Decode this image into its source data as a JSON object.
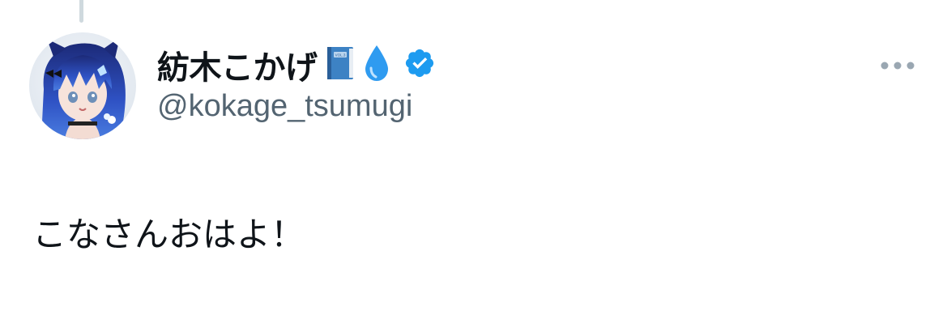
{
  "tweet": {
    "author": {
      "display_name": "紡木こかげ",
      "name_emojis": [
        "blue-book-icon",
        "droplet-icon"
      ],
      "verified": true,
      "handle": "@kokage_tsumugi"
    },
    "text": "こなさんおはよ！",
    "menu_icon": "more-horizontal-icon"
  },
  "colors": {
    "handle": "#536471",
    "verified_badge": "#1d9bf0",
    "thread_line": "#cfd9de",
    "more_dots": "#9aa7b2",
    "book": "#3d82c4",
    "droplet": "#2f9bf0"
  }
}
